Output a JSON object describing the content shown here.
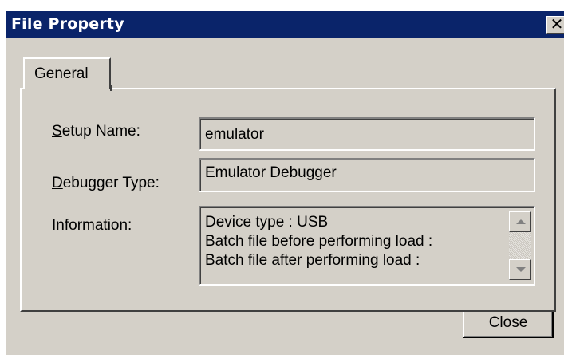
{
  "window": {
    "title": "File Property",
    "close_glyph": "✕"
  },
  "tabs": [
    {
      "label": "General"
    }
  ],
  "form": {
    "setup_name": {
      "mnemonic": "S",
      "label_rest": "etup Name:",
      "value": "emulator"
    },
    "debugger_type": {
      "mnemonic": "D",
      "label_rest": "ebugger Type:",
      "value": "Emulator Debugger"
    },
    "information": {
      "mnemonic": "I",
      "label_rest": "nformation:",
      "lines": [
        "Device type : USB",
        "Batch file before performing load :",
        "Batch file after performing load :"
      ]
    }
  },
  "buttons": {
    "close_label": "Close"
  },
  "colors": {
    "title_bar": "#0a246a",
    "dialog_face": "#d4d0c8"
  }
}
